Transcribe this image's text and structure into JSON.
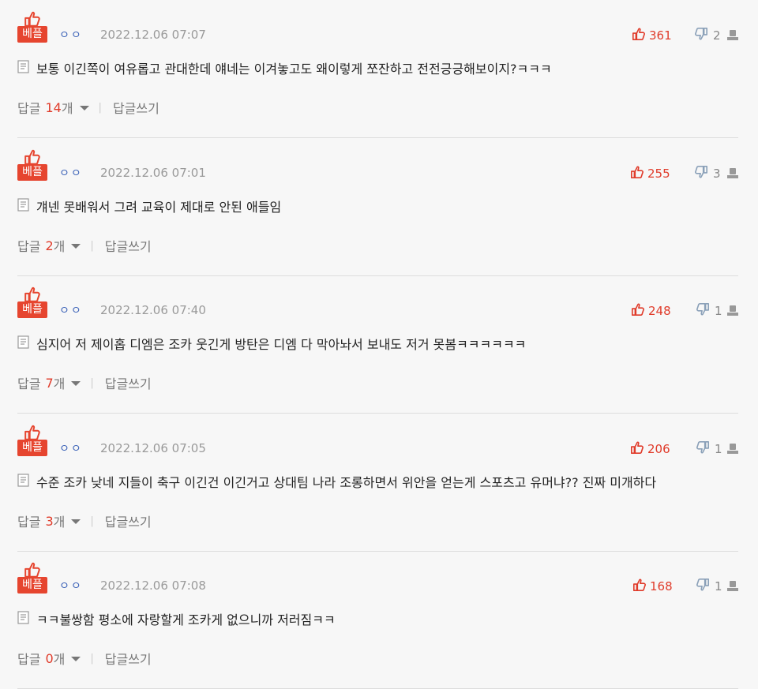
{
  "comments": [
    {
      "badge": "베플",
      "user": "ㅇㅇ",
      "date": "2022.12.06 07:07",
      "likes": "361",
      "dislikes": "2",
      "text": "보통 이긴쪽이 여유롭고 관대한데 얘네는 이겨놓고도 왜이렇게 쪼잔하고 전전긍긍해보이지?ㅋㅋㅋ",
      "reply_label": "답글",
      "reply_count": "14",
      "reply_unit": "개",
      "write_label": "답글쓰기"
    },
    {
      "badge": "베플",
      "user": "ㅇㅇ",
      "date": "2022.12.06 07:01",
      "likes": "255",
      "dislikes": "3",
      "text": "걔넨 못배워서 그려 교육이 제대로 안된 애들임",
      "reply_label": "답글",
      "reply_count": "2",
      "reply_unit": "개",
      "write_label": "답글쓰기"
    },
    {
      "badge": "베플",
      "user": "ㅇㅇ",
      "date": "2022.12.06 07:40",
      "likes": "248",
      "dislikes": "1",
      "text": "심지어 저 제이홉 디엠은 조카 웃긴게 방탄은 디엠 다 막아놔서 보내도 저거 못봄ㅋㅋㅋㅋㅋㅋ",
      "reply_label": "답글",
      "reply_count": "7",
      "reply_unit": "개",
      "write_label": "답글쓰기"
    },
    {
      "badge": "베플",
      "user": "ㅇㅇ",
      "date": "2022.12.06 07:05",
      "likes": "206",
      "dislikes": "1",
      "text": "수준 조카 낮네 지들이 축구 이긴건 이긴거고 상대팀 나라 조롱하면서 위안을 얻는게 스포츠고 유머냐?? 진짜 미개하다",
      "reply_label": "답글",
      "reply_count": "3",
      "reply_unit": "개",
      "write_label": "답글쓰기"
    },
    {
      "badge": "베플",
      "user": "ㅇㅇ",
      "date": "2022.12.06 07:08",
      "likes": "168",
      "dislikes": "1",
      "text": "ㅋㅋ불쌍함 평소에 자랑할게 조카게 없으니까 저러짐ㅋㅋ",
      "reply_label": "답글",
      "reply_count": "0",
      "reply_unit": "개",
      "write_label": "답글쓰기"
    }
  ],
  "colors": {
    "accent": "#e6452f",
    "like": "#e03b2a",
    "user": "#3d63b8",
    "muted": "#9a9a9a"
  },
  "icons": {
    "best": "thumbs-up-icon",
    "like": "thumbs-up-icon",
    "dislike": "thumbs-down-icon",
    "report": "report-icon",
    "memo": "memo-icon",
    "reply_toggle": "chevron-down-icon"
  }
}
